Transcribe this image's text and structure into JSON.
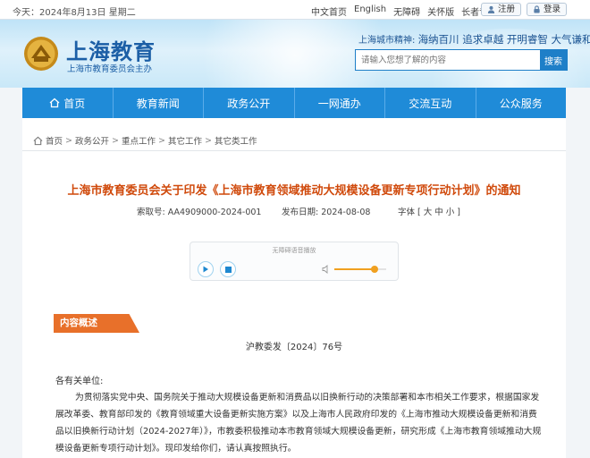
{
  "topbar": {
    "date": "今天：2024年8月13日 星期二",
    "links": [
      "中文首页",
      "English",
      "无障碍",
      "关怀版",
      "长者专版"
    ],
    "register": "注册",
    "login": "登录"
  },
  "header": {
    "logo_title": "上海教育",
    "logo_sub": "上海市教育委员会主办",
    "spirit_prefix": "上海城市精神:",
    "spirit_text": "海纳百川 追求卓越 开明睿智 大气谦和",
    "search_placeholder": "请输入您想了解的内容",
    "search_button": "搜索"
  },
  "nav": {
    "items": [
      "首页",
      "教育新闻",
      "政务公开",
      "一网通办",
      "交流互动",
      "公众服务"
    ]
  },
  "breadcrumb": {
    "items": [
      "首页",
      "政务公开",
      "重点工作",
      "其它工作",
      "其它类工作"
    ],
    "sep": ">"
  },
  "article": {
    "title": "上海市教育委员会关于印发《上海市教育领域推动大规模设备更新专项行动计划》的通知",
    "index_label": "索取号:",
    "index_value": "AA4909000-2024-001",
    "date_label": "发布日期:",
    "date_value": "2024-08-08",
    "font_label": "字体 [ 大 中 小 ]",
    "player_notice": "无障碍语音播放",
    "volume_level": 0.78,
    "section_tag": "内容概述",
    "doc_no": "沪教委发〔2024〕76号",
    "salute": "各有关单位:",
    "body": "为贯彻落实党中央、国务院关于推动大规模设备更新和消费品以旧换新行动的决策部署和本市相关工作要求，根据国家发展改革委、教育部印发的《教育领域重大设备更新实施方案》以及上海市人民政府印发的《上海市推动大规模设备更新和消费品以旧换新行动计划（2024-2027年）》，市教委积极推动本市教育领域大规模设备更新，研究形成《上海市教育领域推动大规模设备更新专项行动计划》。现印发给你们，请认真按照执行。"
  },
  "colors": {
    "nav_blue": "#1f8bd8",
    "title_orange": "#d04a0c",
    "tag_orange": "#e8702a"
  }
}
